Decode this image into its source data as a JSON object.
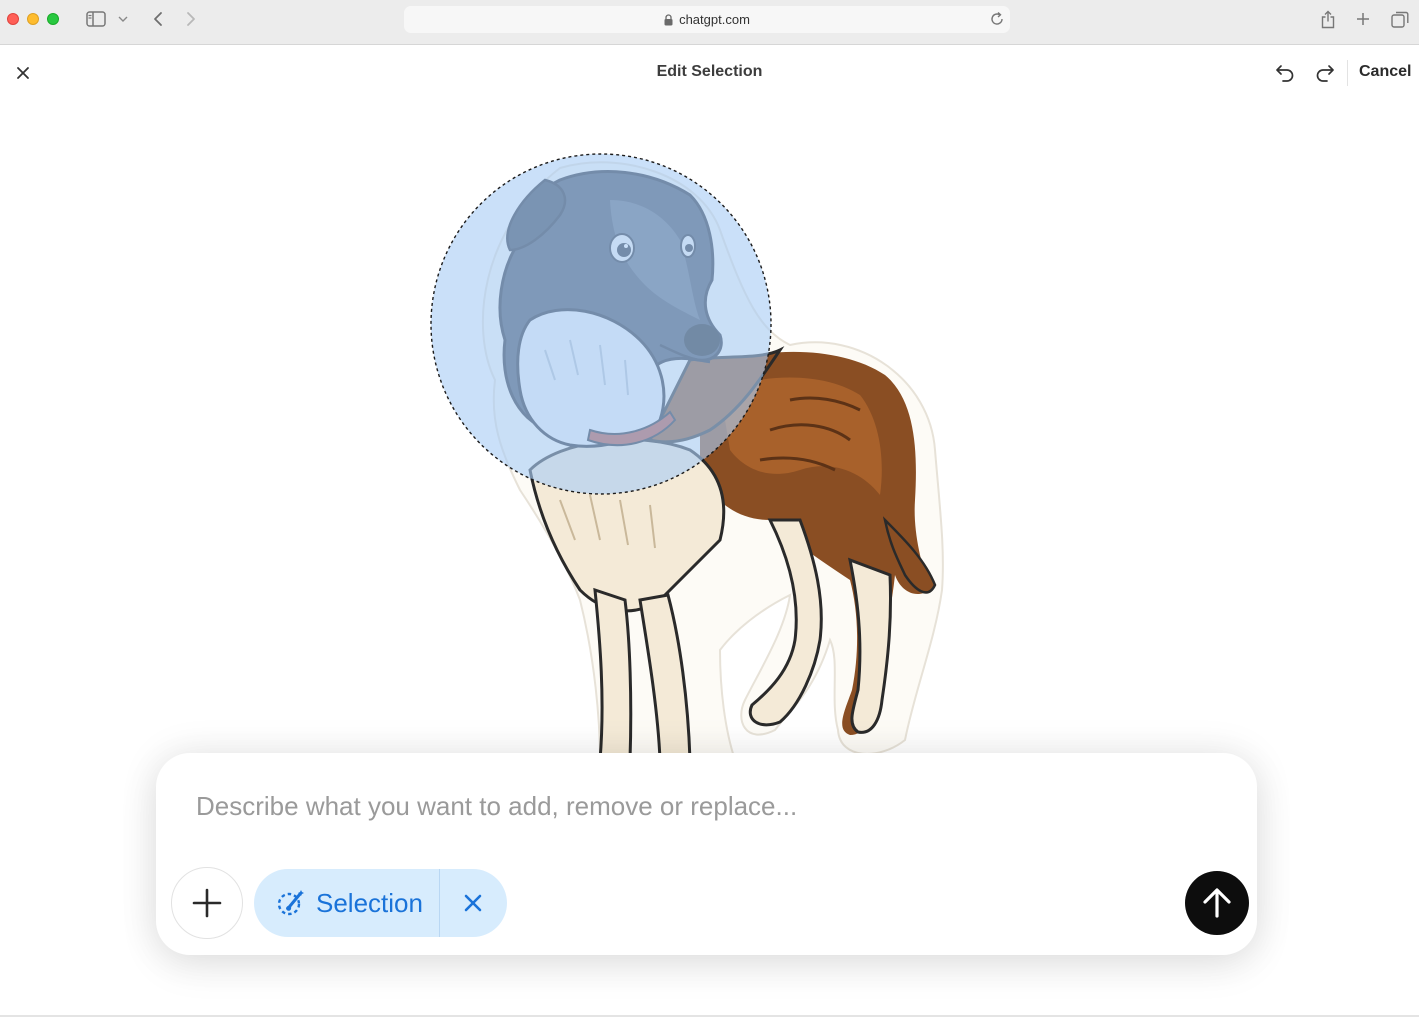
{
  "browser": {
    "url": "chatgpt.com",
    "icons": [
      "sidebar-icon",
      "chevron-down-icon",
      "back-icon",
      "forward-icon",
      "lock-icon",
      "reload-icon",
      "share-icon",
      "new-tab-icon",
      "tabs-overview-icon"
    ]
  },
  "header": {
    "title": "Edit Selection",
    "cancel_label": "Cancel",
    "icons": [
      "close-icon",
      "undo-icon",
      "redo-icon"
    ]
  },
  "canvas": {
    "image_subject": "illustrated borzoi dog sticker",
    "selection_shape": "circle",
    "selection_color": "#a9cdf6"
  },
  "composer": {
    "placeholder": "Describe what you want to add, remove or replace...",
    "value": "",
    "selection_chip_label": "Selection",
    "icons": [
      "plus-icon",
      "selection-brush-icon",
      "remove-selection-icon",
      "send-arrow-icon"
    ]
  },
  "colors": {
    "accent_blue": "#1a73d9",
    "chip_bg": "#d7ecfd",
    "send_button": "#0d0d0d"
  }
}
